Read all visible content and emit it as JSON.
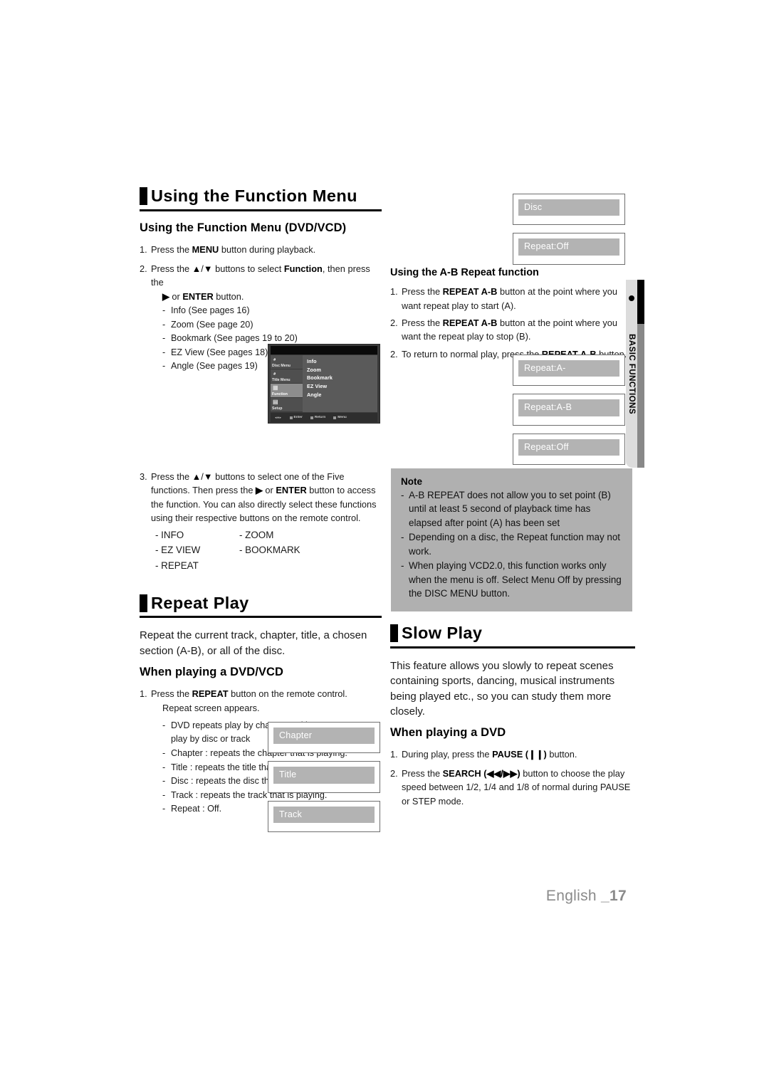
{
  "page": {
    "footer_lang": "English ",
    "footer_number": "_17",
    "side_tab_label": "BASIC FUNCTIONS"
  },
  "left_column": {
    "section_title": "Using the Function Menu",
    "subsection_title": "Using the Function Menu (DVD/VCD)",
    "steps": [
      {
        "num": "1.",
        "text_html": "Press the <b>MENU</b> button during playback."
      },
      {
        "num": "2.",
        "text_html": "Press the <b>▲</b>/<b>▼</b> buttons to select <b>Function</b>, then press the",
        "cont_html": "<b>▶</b> or <b>ENTER</b> button.",
        "items": [
          "Info (See pages 16)",
          "Zoom (See page 20)",
          "Bookmark (See pages 19 to 20)",
          "EZ View (See pages 18)",
          "Angle (See pages 19)"
        ]
      },
      {
        "num": "3.",
        "text_html": "Press the <b>▲</b>/<b>▼</b> buttons to select one of the Five functions. Then press the <b>▶</b> or <b>ENTER</b> button to access the function. You can also directly select these functions using their respective buttons on the remote control."
      }
    ],
    "function_grid": [
      {
        "left": "- INFO",
        "right": "- ZOOM"
      },
      {
        "left": "- EZ VIEW",
        "right": "- BOOKMARK"
      },
      {
        "left": "- REPEAT",
        "right": ""
      }
    ],
    "osd_menu": {
      "sidebar": [
        {
          "label": "Disc Menu",
          "icon": "disc-menu-icon",
          "active": false
        },
        {
          "label": "Title Menu",
          "icon": "title-menu-icon",
          "active": false
        },
        {
          "label": "Function",
          "icon": "function-icon",
          "active": true
        },
        {
          "label": "Setup",
          "icon": "setup-icon",
          "active": false
        }
      ],
      "items": [
        "Info",
        "Zoom",
        "Bookmark",
        "EZ View",
        "Angle"
      ],
      "hints": [
        "Enter",
        "Return",
        "Menu"
      ]
    },
    "repeat_section": {
      "section_title": "Repeat Play",
      "intro": "Repeat the current track, chapter, title, a chosen section (A-B), or all of the disc.",
      "subsection_title": "When playing a DVD/VCD",
      "step_num": "1.",
      "step_text_html": "Press the <b>REPEAT</b> button on the remote control.",
      "step_cont": "Repeat screen appears.",
      "bullets": [
        "DVD repeats play by chapter or title, VCD repeat play by disc or track",
        "Chapter : repeats the chapter that is playing.",
        "Title : repeats the title that is playing.",
        "Disc : repeats the disc that is playing.",
        "Track : repeats the track that is playing.",
        "Repeat : Off."
      ],
      "osd_boxes": [
        "Chapter",
        "Title",
        "Track"
      ]
    }
  },
  "right_column": {
    "top_osd_boxes": [
      "Disc",
      "Repeat:Off"
    ],
    "ab_repeat": {
      "title": "Using the A-B Repeat function",
      "steps": [
        {
          "num": "1.",
          "text_html": "Press the <b>REPEAT A-B</b> button at the point where you want repeat play to start (A)."
        },
        {
          "num": "2.",
          "text_html": "Press the <b>REPEAT A-B</b> button at the point where you want the repeat play to stop (B)."
        },
        {
          "num": "2.",
          "text_html": "To return to normal play, press the <b>REPEAT A-B</b> button."
        }
      ]
    },
    "ab_osd_boxes": [
      "Repeat:A-",
      "Repeat:A-B",
      "Repeat:Off"
    ],
    "note": {
      "title": "Note",
      "items": [
        "A-B REPEAT does not allow you to set point (B) until at least 5 second of playback time has elapsed after point (A) has been set",
        "Depending on a disc, the Repeat function may not work.",
        "When playing VCD2.0, this function works only when the menu is off. Select Menu Off by pressing the DISC MENU button."
      ]
    },
    "slow_play": {
      "section_title": "Slow Play",
      "intro": "This feature allows you slowly to repeat scenes containing sports, dancing, musical instruments being played etc., so you can study them more closely.",
      "subsection_title": "When playing a DVD",
      "steps": [
        {
          "num": "1.",
          "text_html": "During play, press the <b>PAUSE (❙❙)</b> button."
        },
        {
          "num": "2.",
          "text_html": "Press the <b>SEARCH (◀◀/▶▶)</b> button to choose the play speed between 1/2, 1/4 and 1/8 of normal during PAUSE or STEP mode."
        }
      ]
    }
  },
  "colors": {
    "osd_bar": "#b3b3b3",
    "note_bg": "#b0b0b0",
    "side_tab_bg": "#dcdcdc",
    "footer_text": "#8a8a8a"
  }
}
